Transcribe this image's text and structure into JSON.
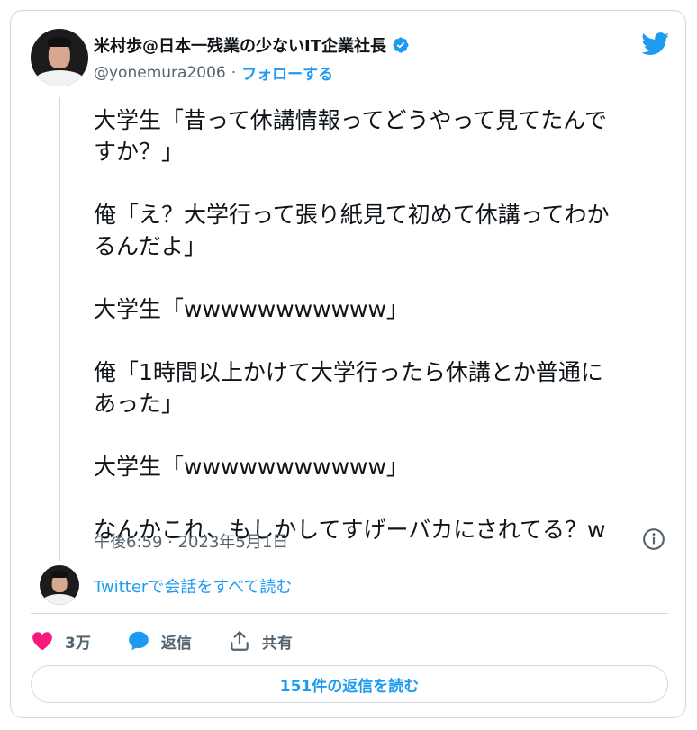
{
  "author": {
    "display_name": "米村歩@日本一残業の少ないIT企業社長",
    "handle": "@yonemura2006",
    "separator": "·",
    "follow_label": "フォローする"
  },
  "tweet": {
    "text": "大学生「昔って休講情報ってどうやって見てたんで\nすか？」\n\n俺「え？大学行って張り紙見て初めて休講ってわか\nるんだよ」\n\n大学生「wwwwwwwwwww」\n\n俺「1時間以上かけて大学行ったら休講とか普通に\nあった」\n\n大学生「wwwwwwwwwww」\n\nなんかこれ、もしかしてすげーバカにされてる？w",
    "timestamp": "午後6:59 · 2023年5月1日"
  },
  "conversation": {
    "read_label": "Twitterで会話をすべて読む"
  },
  "actions": {
    "like_count": "3万",
    "reply_label": "返信",
    "share_label": "共有"
  },
  "replies_button": {
    "label": "151件の返信を読む"
  },
  "colors": {
    "accent": "#1d9bf0",
    "like": "#f91880",
    "secondary_text": "#536471",
    "border": "#cfd9de"
  },
  "icons": [
    "verified-badge-icon",
    "twitter-bird-icon",
    "info-icon",
    "heart-icon",
    "reply-bubble-icon",
    "share-icon"
  ]
}
